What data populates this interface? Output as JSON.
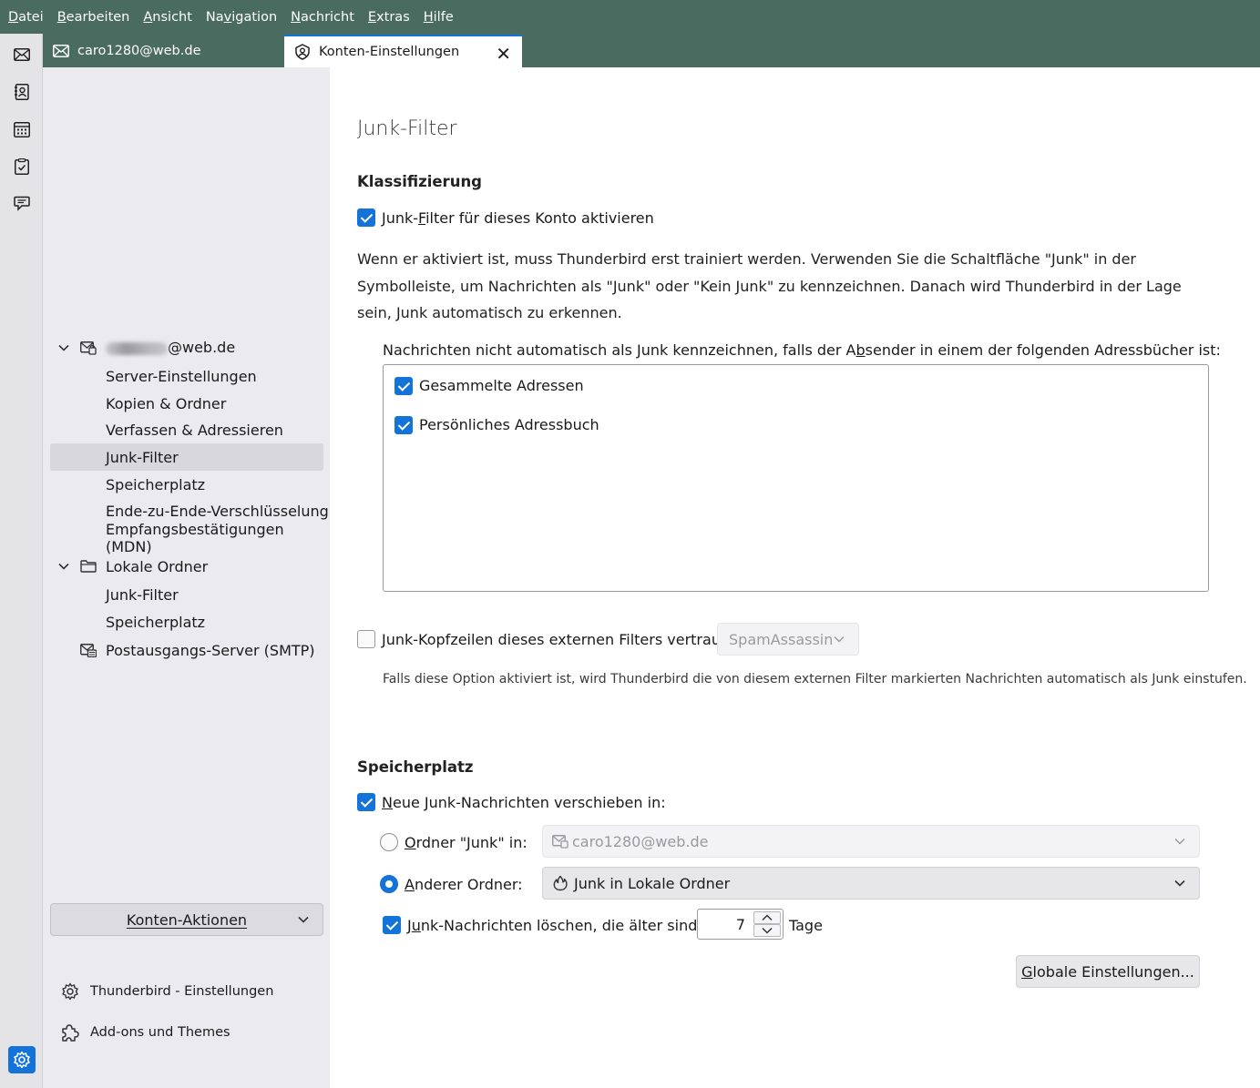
{
  "menubar": {
    "items": [
      {
        "pre": "",
        "ak": "D",
        "post": "atei"
      },
      {
        "pre": "",
        "ak": "B",
        "post": "earbeiten"
      },
      {
        "pre": "",
        "ak": "A",
        "post": "nsicht"
      },
      {
        "pre": "Na",
        "ak": "v",
        "post": "igation"
      },
      {
        "pre": "",
        "ak": "N",
        "post": "achricht"
      },
      {
        "pre": "",
        "ak": "E",
        "post": "xtras"
      },
      {
        "pre": "",
        "ak": "H",
        "post": "ilfe"
      }
    ]
  },
  "tabs": {
    "mail_tab": "caro1280@web.de",
    "settings_tab": "Konten-Einstellungen"
  },
  "sidebar": {
    "account_suffix": "@web.de",
    "account_items": [
      "Server-Einstellungen",
      "Kopien & Ordner",
      "Verfassen & Adressieren",
      "Junk-Filter",
      "Speicherplatz",
      "Ende-zu-Ende-Verschlüsselung",
      "Empfangsbestätigungen (MDN)"
    ],
    "local_folders": "Lokale Ordner",
    "local_items": [
      "Junk-Filter",
      "Speicherplatz"
    ],
    "smtp": "Postausgangs-Server (SMTP)",
    "konten_aktionen": "Konten-Aktionen",
    "tb_settings": "Thunderbird - Einstellungen",
    "addons": "Add-ons und Themes"
  },
  "main": {
    "title": "Junk-Filter",
    "klassifizierung": "Klassifizierung",
    "enable_junk": {
      "pre": "Junk-",
      "ak": "F",
      "post": "ilter für dieses Konto aktivieren"
    },
    "description": "Wenn er aktiviert ist, muss Thunderbird erst trainiert werden. Verwenden Sie die Schaltfläche \"Junk\" in der Symbolleiste, um Nachrichten als \"Junk\" oder \"Kein Junk\" zu kennzeichnen. Danach wird Thunderbird in der Lage sein, Junk automatisch zu erkennen.",
    "whitelist_label": {
      "pre": "Nachrichten nicht automatisch als Junk kennzeichnen, falls der A",
      "ak": "b",
      "post": "sender in einem der folgenden Adressbücher ist:"
    },
    "addressbooks": [
      "Gesammelte Adressen",
      "Persönliches Adressbuch"
    ],
    "trust_headers": {
      "pre": "",
      "ak": "J",
      "post": "unk-Kopfzeilen dieses externen Filters vertrauen:"
    },
    "trust_select": "SpamAssassin",
    "trust_note": "Falls diese Option aktiviert ist, wird Thunderbird die von diesem externen Filter markierten Nachrichten automatisch als Junk einstufen.",
    "speicherplatz": "Speicherplatz",
    "move_new": {
      "pre": "",
      "ak": "N",
      "post": "eue Junk-Nachrichten verschieben in:"
    },
    "junk_folder_radio": {
      "pre": "",
      "ak": "O",
      "post": "rdner \"Junk\" in:"
    },
    "junk_folder_select": "caro1280@web.de",
    "other_folder_radio": {
      "pre": "",
      "ak": "A",
      "post": "nderer Ordner:"
    },
    "other_folder_select": "Junk in Lokale Ordner",
    "purge": {
      "pre": "J",
      "ak": "u",
      "post": "nk-Nachrichten löschen, die älter sind als"
    },
    "purge_days": "7",
    "days_unit": "Tage",
    "global_btn": {
      "pre": "",
      "ak": "G",
      "post": "lobale Einstellungen..."
    }
  },
  "colors": {
    "accent": "#1373d9",
    "titlebar": "#4a6b5f"
  }
}
